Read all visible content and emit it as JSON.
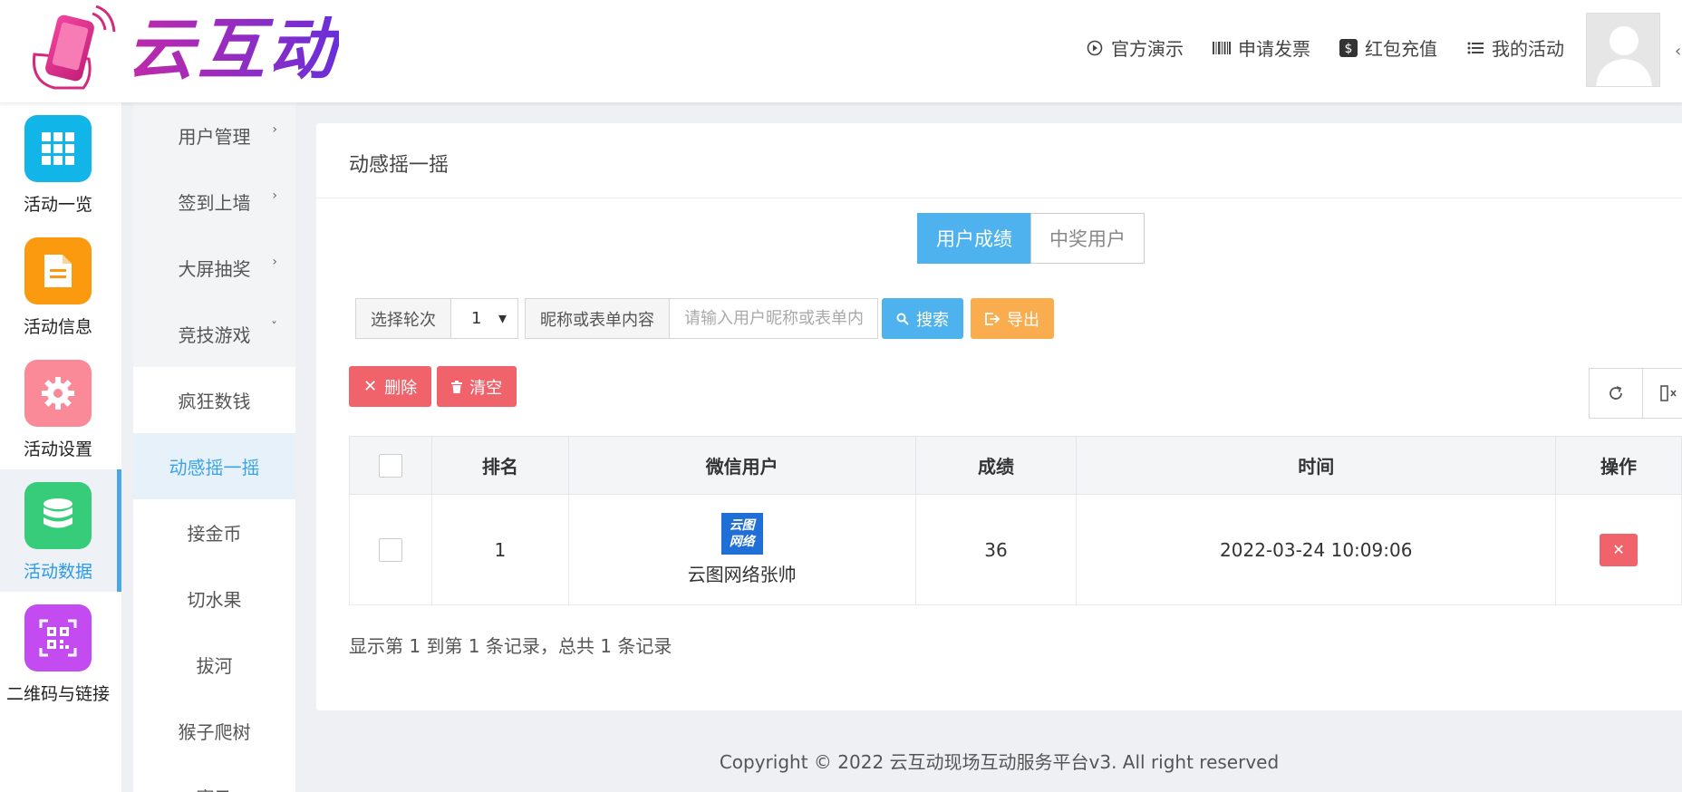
{
  "header": {
    "brand": "云互动",
    "nav": [
      {
        "label": "官方演示",
        "icon": "play-circle-icon"
      },
      {
        "label": "申请发票",
        "icon": "barcode-icon"
      },
      {
        "label": "红包充值",
        "icon": "dollar-icon"
      },
      {
        "label": "我的活动",
        "icon": "list-icon"
      }
    ]
  },
  "sidebar": {
    "items": [
      {
        "label": "活动一览",
        "color": "#12b5e8",
        "icon": "grid-icon"
      },
      {
        "label": "活动信息",
        "color": "#fb9a0e",
        "icon": "document-icon"
      },
      {
        "label": "活动设置",
        "color": "#fb8a98",
        "icon": "gear-icon"
      },
      {
        "label": "活动数据",
        "color": "#37cc7a",
        "icon": "database-icon",
        "active": true
      },
      {
        "label": "二维码与链接",
        "color": "#c44bf0",
        "icon": "qrcode-icon"
      }
    ]
  },
  "submenu": {
    "groups": [
      {
        "label": "用户管理",
        "chevron": "›"
      },
      {
        "label": "签到上墙",
        "chevron": "›"
      },
      {
        "label": "大屏抽奖",
        "chevron": "›"
      },
      {
        "label": "竞技游戏",
        "chevron": "ˇ"
      }
    ],
    "children": [
      {
        "label": "疯狂数钱"
      },
      {
        "label": "动感摇一摇",
        "active": true
      },
      {
        "label": "接金币"
      },
      {
        "label": "切水果"
      },
      {
        "label": "拔河"
      },
      {
        "label": "猴子爬树"
      },
      {
        "label": "赛马"
      }
    ]
  },
  "main": {
    "title": "动感摇一摇",
    "tabs": [
      {
        "label": "用户成绩",
        "active": true
      },
      {
        "label": "中奖用户",
        "active": false
      }
    ],
    "filter": {
      "round_label": "选择轮次",
      "round_value": "1",
      "keyword_label": "昵称或表单内容",
      "keyword_placeholder": "请输入用户昵称或表单内容",
      "search_label": "搜索",
      "export_label": "导出"
    },
    "actions": {
      "delete_label": "删除",
      "clear_label": "清空"
    },
    "table": {
      "columns": [
        "排名",
        "微信用户",
        "成绩",
        "时间",
        "操作"
      ],
      "rows": [
        {
          "rank": "1",
          "user_logo": "云图网络",
          "user": "云图网络张帅",
          "score": "36",
          "time": "2022-03-24 10:09:06"
        }
      ]
    },
    "records_text": "显示第 1 到第 1 条记录，总共 1 条记录"
  },
  "footer": {
    "copyright": "Copyright © 2022 云互动现场互动服务平台v3. All right reserved"
  }
}
